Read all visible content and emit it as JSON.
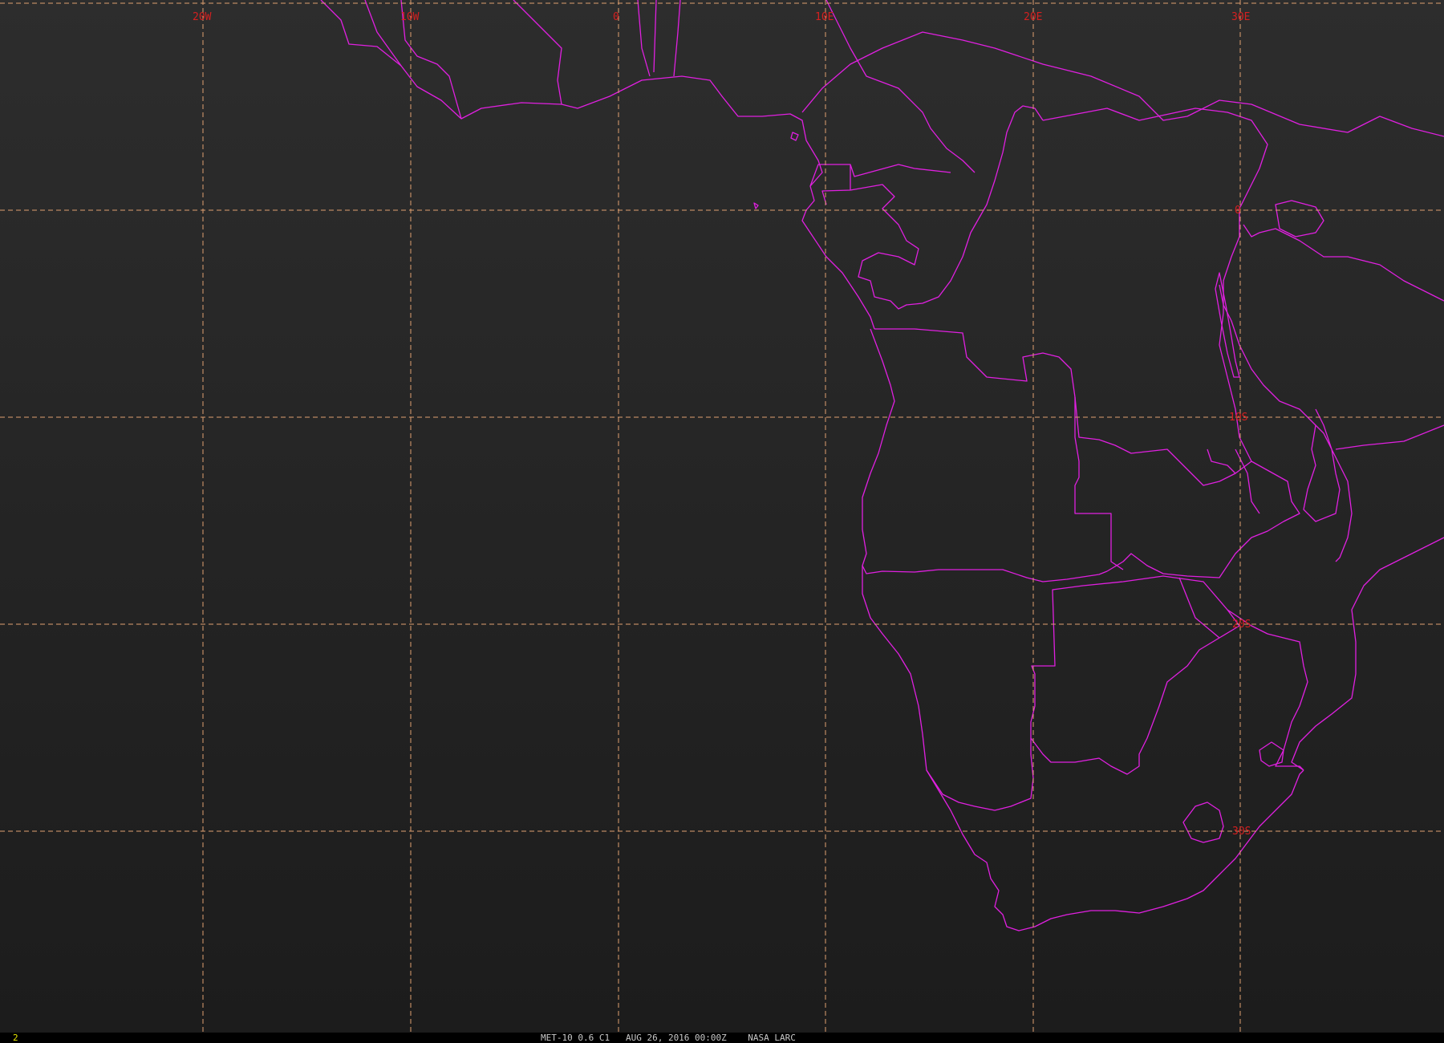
{
  "colors": {
    "background_top": "#2d2d2d",
    "background_bottom": "#1c1c1c",
    "grid": "#e0a070",
    "grid_label": "#d42020",
    "boundary": "#e020e0",
    "frame_number": "#e6e600",
    "caption": "#c8c8c8"
  },
  "grid_labels": {
    "longitude": [
      "20W",
      "10W",
      "0",
      "10E",
      "20E",
      "30E"
    ],
    "latitude": [
      "0",
      "10S",
      "20S",
      "30S"
    ]
  },
  "footer": {
    "frame_number": "2",
    "caption": "MET-10 0.6 C1   AUG 26, 2016 00:00Z    NASA LARC"
  }
}
